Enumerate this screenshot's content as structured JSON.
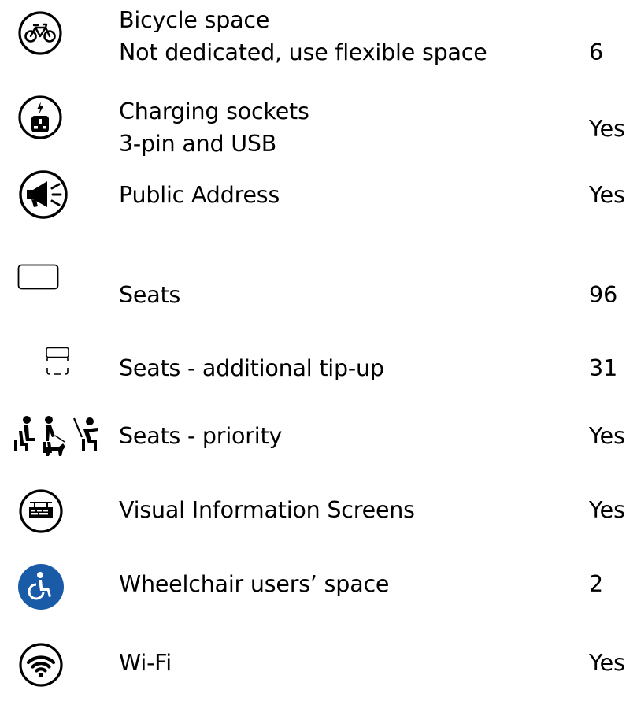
{
  "colors": {
    "text": "#000000",
    "wheelchair_badge": "#1a5ba8"
  },
  "items": [
    {
      "icon": "bicycle-icon",
      "label": "Bicycle space",
      "sublabel": "Not dedicated, use flexible space",
      "value": "6"
    },
    {
      "icon": "charging-socket-icon",
      "label": "Charging sockets",
      "sublabel": "3-pin and USB",
      "value": "Yes"
    },
    {
      "icon": "megaphone-icon",
      "label": "Public Address",
      "value": "Yes"
    },
    {
      "icon": "seat-icon",
      "label": "Seats",
      "value": "96"
    },
    {
      "icon": "tip-up-seat-icon",
      "label": "Seats - additional tip-up",
      "value": "31"
    },
    {
      "icon": "priority-seat-icon",
      "label": "Seats - priority",
      "value": "Yes"
    },
    {
      "icon": "information-screen-icon",
      "label": "Visual Information Screens",
      "value": "Yes"
    },
    {
      "icon": "wheelchair-icon",
      "label": "Wheelchair users’ space",
      "value": "2"
    },
    {
      "icon": "wifi-icon",
      "label": "Wi-Fi",
      "value": "Yes"
    }
  ]
}
